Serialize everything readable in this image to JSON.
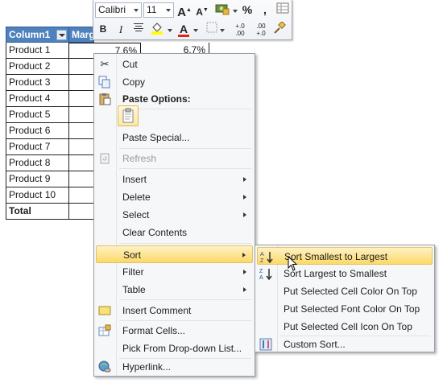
{
  "table": {
    "headers": [
      "Column1",
      "Marg"
    ],
    "rows": [
      {
        "name": "Product 1",
        "col2": "7.6%",
        "col3": "6.7%"
      },
      {
        "name": "Product 2",
        "col2": "",
        "col3": ""
      },
      {
        "name": "Product 3",
        "col2": "",
        "col3": ""
      },
      {
        "name": "Product 4",
        "col2": "",
        "col3": ""
      },
      {
        "name": "Product 5",
        "col2": "",
        "col3": ""
      },
      {
        "name": "Product 6",
        "col2": "",
        "col3": ""
      },
      {
        "name": "Product 7",
        "col2": "",
        "col3": ""
      },
      {
        "name": "Product 8",
        "col2": "",
        "col3": ""
      },
      {
        "name": "Product 9",
        "col2": "",
        "col3": ""
      },
      {
        "name": "Product 10",
        "col2": "",
        "col3": ""
      }
    ],
    "total_label": "Total"
  },
  "mini_toolbar": {
    "font_name": "Calibri",
    "font_size": "11",
    "grow": "A",
    "shrink": "A",
    "percent": "%",
    "comma": ",",
    "bold": "B",
    "italic": "I",
    "inc_decimal": "+.0 .00",
    "dec_decimal": ".00 +.0",
    "font_color_letter": "A"
  },
  "context_menu": {
    "items": [
      {
        "label": "Cut",
        "icon": "scissors-icon"
      },
      {
        "label": "Copy",
        "icon": "copy-icon"
      },
      {
        "label": "Paste Options:",
        "icon": "paste-icon"
      },
      {
        "label": "Paste Special...",
        "icon": ""
      },
      {
        "label": "Refresh",
        "icon": "refresh-icon",
        "disabled": true
      },
      {
        "label": "Insert",
        "submenu": true
      },
      {
        "label": "Delete",
        "submenu": true
      },
      {
        "label": "Select",
        "submenu": true
      },
      {
        "label": "Clear Contents"
      },
      {
        "label": "Sort",
        "submenu": true,
        "highlighted": true
      },
      {
        "label": "Filter",
        "submenu": true
      },
      {
        "label": "Table",
        "submenu": true
      },
      {
        "label": "Insert Comment",
        "icon": "comment-icon"
      },
      {
        "label": "Format Cells...",
        "icon": "format-cells-icon"
      },
      {
        "label": "Pick From Drop-down List..."
      },
      {
        "label": "Hyperlink...",
        "icon": "hyperlink-icon"
      }
    ]
  },
  "sort_submenu": {
    "items": [
      {
        "label": "Sort Smallest to Largest",
        "icon": "sort-ascending-icon",
        "highlighted": true
      },
      {
        "label": "Sort Largest to Smallest",
        "icon": "sort-descending-icon"
      },
      {
        "label": "Put Selected Cell Color On Top"
      },
      {
        "label": "Put Selected Font Color On Top"
      },
      {
        "label": "Put Selected Cell Icon On Top"
      },
      {
        "label": "Custom Sort...",
        "icon": "custom-sort-icon"
      }
    ]
  },
  "colors": {
    "header_blue": "#4f81bd",
    "highlight": "#fbd968",
    "fill_yellow": "#ffff00",
    "font_red": "#e2231a"
  }
}
